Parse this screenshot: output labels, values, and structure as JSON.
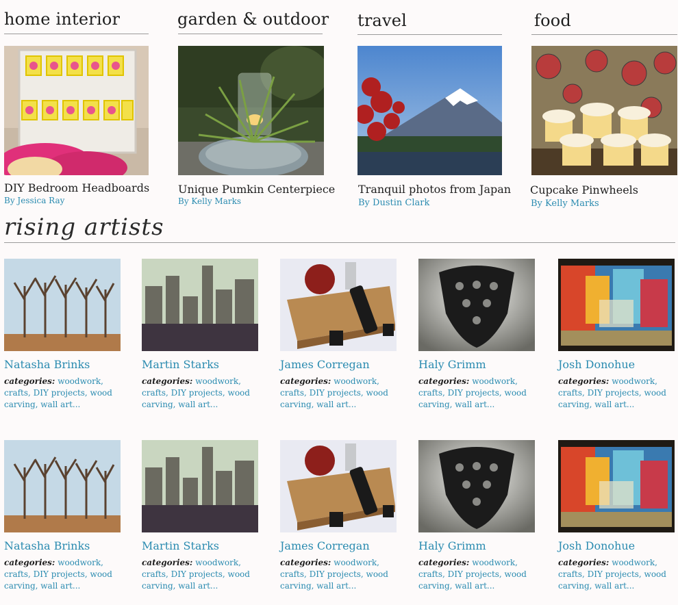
{
  "categories": [
    {
      "title": "home interior",
      "caption": "DIY Bedroom Headboards",
      "author": "By Jessica Ray",
      "image": "headboard-photo"
    },
    {
      "title": "garden & outdoor",
      "caption": "Unique Pumkin Centerpiece",
      "author": "By Kelly Marks",
      "image": "pumpkin-centerpiece-photo"
    },
    {
      "title": "travel",
      "caption": "Tranquil photos from Japan",
      "author": "By Dustin Clark",
      "image": "mount-fuji-photo"
    },
    {
      "title": "food",
      "caption": "Cupcake Pinwheels",
      "author": "By Kelly Marks",
      "image": "cupcake-pinwheels-photo"
    }
  ],
  "rising_artists": {
    "title": "rising artists",
    "categories_label": "categories:",
    "rows": [
      [
        {
          "name": "Natasha Brinks",
          "categories": "woodwork, crafts, DIY projects, wood carving, wall art...",
          "image": "wooden-trees-photo"
        },
        {
          "name": "Martin Starks",
          "categories": "woodwork, crafts, DIY projects, wood carving, wall art...",
          "image": "city-skyline-photo"
        },
        {
          "name": "James Corregan",
          "categories": "woodwork, crafts, DIY projects, wood carving, wall art...",
          "image": "cutting-board-photo"
        },
        {
          "name": "Haly Grimm",
          "categories": "woodwork, crafts, DIY projects, wood carving, wall art...",
          "image": "lace-chandelier-photo"
        },
        {
          "name": "Josh Donohue",
          "categories": "woodwork, crafts, DIY projects, wood carving, wall art...",
          "image": "colorful-painting-photo"
        }
      ],
      [
        {
          "name": "Natasha Brinks",
          "categories": "woodwork, crafts, DIY projects, wood carving, wall art...",
          "image": "wooden-trees-photo"
        },
        {
          "name": "Martin Starks",
          "categories": "woodwork, crafts, DIY projects, wood carving, wall art...",
          "image": "city-skyline-photo"
        },
        {
          "name": "James Corregan",
          "categories": "woodwork, crafts, DIY projects, wood carving, wall art...",
          "image": "cutting-board-photo"
        },
        {
          "name": "Haly Grimm",
          "categories": "woodwork, crafts, DIY projects, wood carving, wall art...",
          "image": "lace-chandelier-photo"
        },
        {
          "name": "Josh Donohue",
          "categories": "woodwork, crafts, DIY projects, wood carving, wall art...",
          "image": "colorful-painting-photo"
        }
      ]
    ]
  },
  "colors": {
    "link": "#2a8bb0",
    "text": "#1e1e1e",
    "background": "#fdfafa",
    "rule": "#9a9a9a"
  }
}
